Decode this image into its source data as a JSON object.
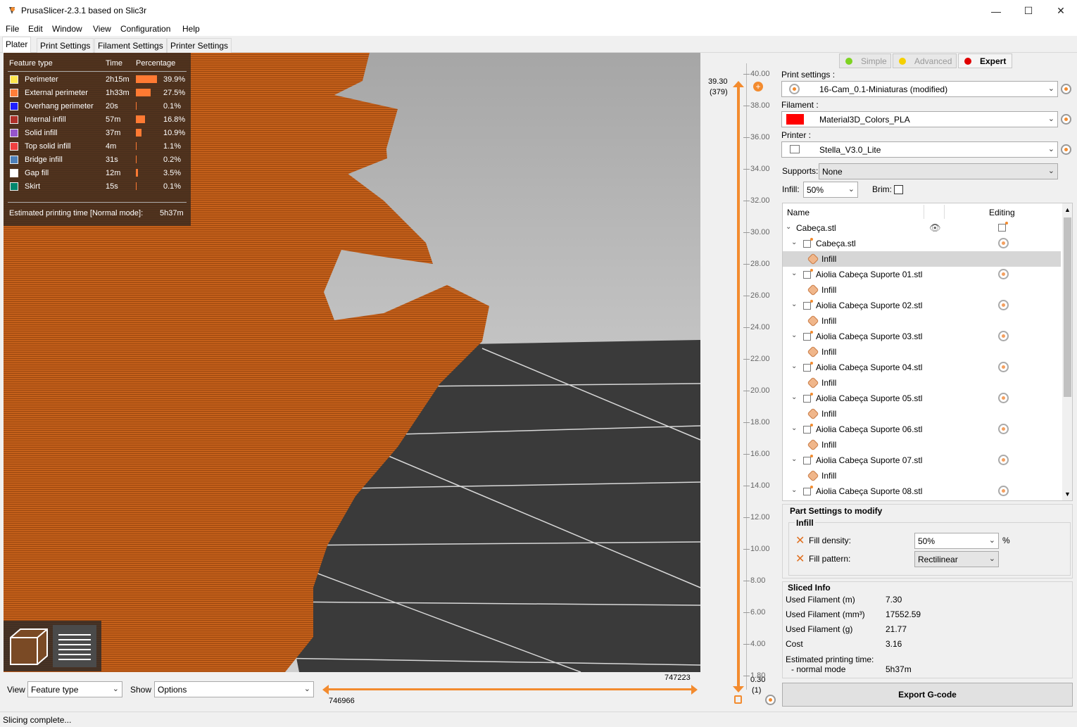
{
  "window": {
    "title": "PrusaSlicer-2.3.1 based on Slic3r"
  },
  "menu": [
    "File",
    "Edit",
    "Window",
    "View",
    "Configuration",
    "Help"
  ],
  "tabs": [
    "Plater",
    "Print Settings",
    "Filament Settings",
    "Printer Settings"
  ],
  "legend": {
    "headers": {
      "type": "Feature type",
      "time": "Time",
      "pct": "Percentage"
    },
    "rows": [
      {
        "name": "Perimeter",
        "time": "2h15m",
        "pct": "39.9%",
        "color": "#FFE64D",
        "fraction": 0.399
      },
      {
        "name": "External perimeter",
        "time": "1h33m",
        "pct": "27.5%",
        "color": "#FF7D38",
        "fraction": 0.275
      },
      {
        "name": "Overhang perimeter",
        "time": "20s",
        "pct": "0.1%",
        "color": "#1F1FFF",
        "fraction": 0.001
      },
      {
        "name": "Internal infill",
        "time": "57m",
        "pct": "16.8%",
        "color": "#B03029",
        "fraction": 0.168
      },
      {
        "name": "Solid infill",
        "time": "37m",
        "pct": "10.9%",
        "color": "#9654CC",
        "fraction": 0.109
      },
      {
        "name": "Top solid infill",
        "time": "4m",
        "pct": "1.1%",
        "color": "#F04040",
        "fraction": 0.011
      },
      {
        "name": "Bridge infill",
        "time": "31s",
        "pct": "0.2%",
        "color": "#4D80BA",
        "fraction": 0.002
      },
      {
        "name": "Gap fill",
        "time": "12m",
        "pct": "3.5%",
        "color": "#FFFFFF",
        "fraction": 0.035
      },
      {
        "name": "Skirt",
        "time": "15s",
        "pct": "0.1%",
        "color": "#00876E",
        "fraction": 0.001
      }
    ],
    "estimated": "Estimated printing time [Normal mode]:",
    "estimated_value": "5h37m"
  },
  "vslider": {
    "top_value": "39.30",
    "top_layer": "(379)",
    "bottom_value": "0.30",
    "bottom_layer": "(1)",
    "ticks": [
      "40.00",
      "38.00",
      "36.00",
      "34.00",
      "32.00",
      "30.00",
      "28.00",
      "26.00",
      "24.00",
      "22.00",
      "20.00",
      "18.00",
      "16.00",
      "14.00",
      "12.00",
      "10.00",
      "8.00",
      "6.00",
      "4.00",
      "1.80"
    ]
  },
  "hslider": {
    "right_value": "747223",
    "left_value": "746966"
  },
  "bottom": {
    "view_label": "View",
    "view_value": "Feature type",
    "show_label": "Show",
    "show_value": "Options"
  },
  "modes": {
    "simple": "Simple",
    "advanced": "Advanced",
    "expert": "Expert"
  },
  "print_settings": {
    "label": "Print settings :",
    "value": "16-Cam_0.1-Miniaturas (modified)"
  },
  "filament": {
    "label": "Filament :",
    "value": "Material3D_Colors_PLA",
    "color": "#FF0000"
  },
  "printer": {
    "label": "Printer :",
    "value": "Stella_V3.0_Lite"
  },
  "supports": {
    "label": "Supports:",
    "value": "None"
  },
  "infill": {
    "label": "Infill:",
    "value": "50%"
  },
  "brim": {
    "label": "Brim:"
  },
  "tree": {
    "col_name": "Name",
    "col_editing": "Editing",
    "rows": [
      {
        "label": "Cabeça.stl",
        "level": 0,
        "kind": "object"
      },
      {
        "label": "Cabeça.stl",
        "level": 1,
        "kind": "part"
      },
      {
        "label": "Infill",
        "level": 2,
        "kind": "setting"
      },
      {
        "label": "Aiolia Cabeça Suporte 01.stl",
        "level": 1,
        "kind": "part"
      },
      {
        "label": "Infill",
        "level": 2,
        "kind": "setting"
      },
      {
        "label": "Aiolia Cabeça Suporte 02.stl",
        "level": 1,
        "kind": "part"
      },
      {
        "label": "Infill",
        "level": 2,
        "kind": "setting"
      },
      {
        "label": "Aiolia Cabeça Suporte 03.stl",
        "level": 1,
        "kind": "part"
      },
      {
        "label": "Infill",
        "level": 2,
        "kind": "setting"
      },
      {
        "label": "Aiolia Cabeça Suporte 04.stl",
        "level": 1,
        "kind": "part"
      },
      {
        "label": "Infill",
        "level": 2,
        "kind": "setting"
      },
      {
        "label": "Aiolia Cabeça Suporte 05.stl",
        "level": 1,
        "kind": "part"
      },
      {
        "label": "Infill",
        "level": 2,
        "kind": "setting"
      },
      {
        "label": "Aiolia Cabeça Suporte 06.stl",
        "level": 1,
        "kind": "part"
      },
      {
        "label": "Infill",
        "level": 2,
        "kind": "setting"
      },
      {
        "label": "Aiolia Cabeça Suporte 07.stl",
        "level": 1,
        "kind": "part"
      },
      {
        "label": "Infill",
        "level": 2,
        "kind": "setting"
      },
      {
        "label": "Aiolia Cabeça Suporte 08.stl",
        "level": 1,
        "kind": "part"
      }
    ]
  },
  "part_settings": {
    "title": "Part Settings to modify",
    "group": "Infill",
    "fill_density_label": "Fill density:",
    "fill_density_value": "50%",
    "fill_density_unit": "%",
    "fill_pattern_label": "Fill pattern:",
    "fill_pattern_value": "Rectilinear"
  },
  "sliced_info": {
    "title": "Sliced Info",
    "rows": [
      {
        "label": "Used Filament (m)",
        "value": "7.30"
      },
      {
        "label": "Used Filament (mm³)",
        "value": "17552.59"
      },
      {
        "label": "Used Filament (g)",
        "value": "21.77"
      },
      {
        "label": "Cost",
        "value": "3.16"
      }
    ],
    "time_label": "Estimated printing time:",
    "mode_label": "- normal mode",
    "mode_value": "5h37m"
  },
  "export_label": "Export G-code",
  "status": "Slicing complete..."
}
